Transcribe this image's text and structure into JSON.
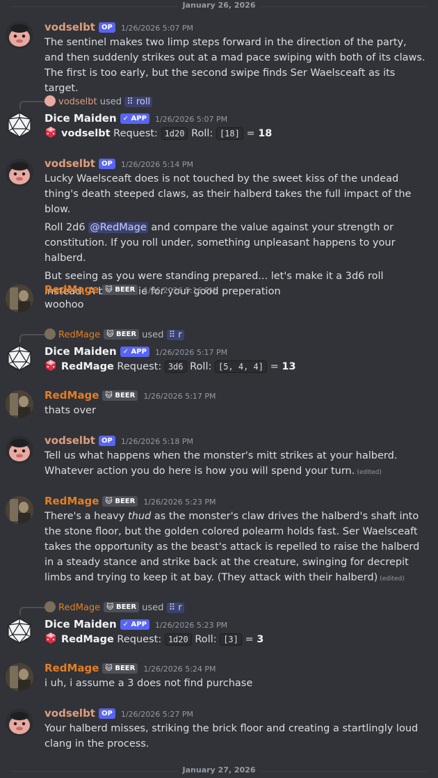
{
  "dividers": {
    "top": "January 26, 2026",
    "bottom": "January 27, 2026"
  },
  "colors": {
    "background": "#313338",
    "accent": "#5865f2",
    "redmage": "#e67e22"
  },
  "badges": {
    "op": "OP",
    "app": "✓ APP",
    "beer": "🐱 BEER"
  },
  "reply_used": "used",
  "messages": [
    {
      "author": "vodselbt",
      "time": "1/26/2026 5:07 PM",
      "text": "The sentinel makes two limp steps forward in the direction of the party, and then suddenly strikes out at a mad pace swiping with both of its claws. The first is too early, but the second swipe finds Ser Waelsceaft as its target."
    },
    {
      "author": "Dice Maiden",
      "time": "1/26/2026 5:07 PM",
      "reply_user": "vodselbt",
      "reply_cmd": "roll",
      "roller": "vodselbt",
      "req_label": "Request:",
      "request": "1d20",
      "roll_label": "Roll:",
      "roll": "[18]",
      "eq": "=",
      "total": "18"
    },
    {
      "author": "vodselbt",
      "time": "1/26/2026 5:14 PM",
      "p1": "Lucky Waelsceaft does is not touched by the sweet kiss of the undead thing's death steeped claws, as their halberd takes the full impact of the blow.",
      "p2a": "Roll 2d6",
      "mention": "@RedMage",
      "p2b": "and compare the value against your strength or constitution. If you roll under, something unpleasant happens to your halberd.",
      "p3": "But seeing as you were standing prepared... let's make it a 3d6 roll instead. A bonus die for your good preperation"
    },
    {
      "author": "RedMage",
      "time": "1/26/2026 5:16 PM",
      "text": "woohoo"
    },
    {
      "author": "Dice Maiden",
      "time": "1/26/2026 5:17 PM",
      "reply_user": "RedMage",
      "reply_cmd": "r",
      "roller": "RedMage",
      "req_label": "Request:",
      "request": "3d6",
      "roll_label": "Roll:",
      "roll": "[5, 4, 4]",
      "eq": "=",
      "total": "13"
    },
    {
      "author": "RedMage",
      "time": "1/26/2026 5:17 PM",
      "text": "thats over"
    },
    {
      "author": "vodselbt",
      "time": "1/26/2026 5:18 PM",
      "text": "Tell us what happens when the monster's mitt strikes at your halberd. Whatever action you do here is how you will spend your turn.",
      "edited": "(edited)"
    },
    {
      "author": "RedMage",
      "time": "1/26/2026 5:23 PM",
      "t1": "There's a heavy ",
      "em": "thud",
      "t2": " as the monster's claw drives the halberd's shaft into the stone floor, but the golden colored polearm holds fast. Ser Waelsceaft takes the opportunity as the beast's attack is repelled to raise the halberd in a steady stance and strike back at the creature, swinging for decrepit limbs and trying to keep it at bay. (They attack with their halberd)",
      "edited": "(edited)"
    },
    {
      "author": "Dice Maiden",
      "time": "1/26/2026 5:23 PM",
      "reply_user": "RedMage",
      "reply_cmd": "r",
      "roller": "RedMage",
      "req_label": "Request:",
      "request": "1d20",
      "roll_label": "Roll:",
      "roll": "[3]",
      "eq": "=",
      "total": "3"
    },
    {
      "author": "RedMage",
      "time": "1/26/2026 5:24 PM",
      "text": "i uh, i assume a 3 does not find purchase"
    },
    {
      "author": "vodselbt",
      "time": "1/26/2026 5:27 PM",
      "text": "Your halberd misses, striking the brick floor and creating a startlingly loud clang in the process."
    }
  ]
}
